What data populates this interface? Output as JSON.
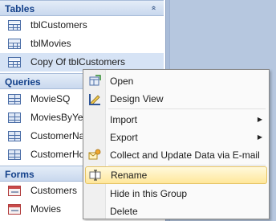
{
  "nav": {
    "groups": [
      {
        "header": "Tables",
        "chevron": "»",
        "items": [
          "tblCustomers",
          "tblMovies",
          "Copy Of tblCustomers"
        ]
      },
      {
        "header": "Queries",
        "items": [
          "MovieSQ",
          "MoviesByYea",
          "CustomerNa",
          "CustomerHo"
        ]
      },
      {
        "header": "Forms",
        "items": [
          "Customers",
          "Movies"
        ]
      }
    ]
  },
  "context_menu": {
    "items": [
      {
        "label": "Open",
        "icon": "open-icon"
      },
      {
        "label": "Design View",
        "icon": "design-view-icon"
      },
      {
        "label": "Import",
        "submenu": true
      },
      {
        "label": "Export",
        "submenu": true
      },
      {
        "label": "Collect and Update Data via E-mail",
        "icon": "collect-data-icon"
      },
      {
        "label": "Rename",
        "icon": "rename-icon",
        "highlighted": true
      },
      {
        "label": "Hide in this Group"
      },
      {
        "label": "Delete"
      }
    ]
  },
  "colors": {
    "header_text": "#15428b",
    "highlight_bg": "#ffe79a",
    "selected_row": "#d6e3f5",
    "workspace": "#b6c7df"
  }
}
